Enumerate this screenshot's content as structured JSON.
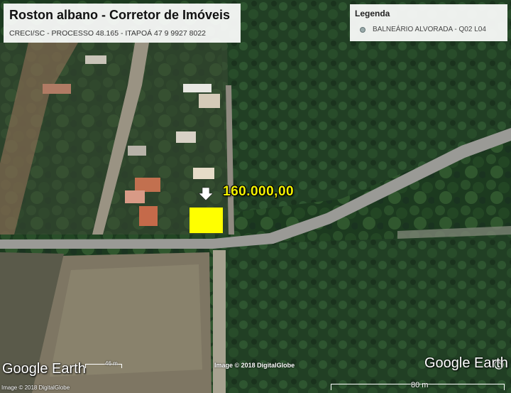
{
  "title": {
    "main": "Roston albano - Corretor de Imóveis",
    "sub": "CRECI/SC - PROCESSO 48.165 - ITAPOÁ 47 9 9927 8022"
  },
  "legend": {
    "title": "Legenda",
    "items": [
      {
        "label": "BALNEÁRIO ALVORADA - Q02 L04",
        "icon": "placemark-dot-icon"
      }
    ]
  },
  "marker": {
    "price": "160.000,00",
    "lot_color": "#ffff00",
    "arrow_icon": "down-arrow-icon"
  },
  "credits": {
    "logo_left": "Google Earth",
    "logo_right": "Google Earth",
    "image_credit": "Image © 2018 DigitalGlobe",
    "small_credit": "Image © 2018 DigitalGlobe"
  },
  "scales": {
    "small_label": "46 m",
    "bar_label": "80 m"
  }
}
